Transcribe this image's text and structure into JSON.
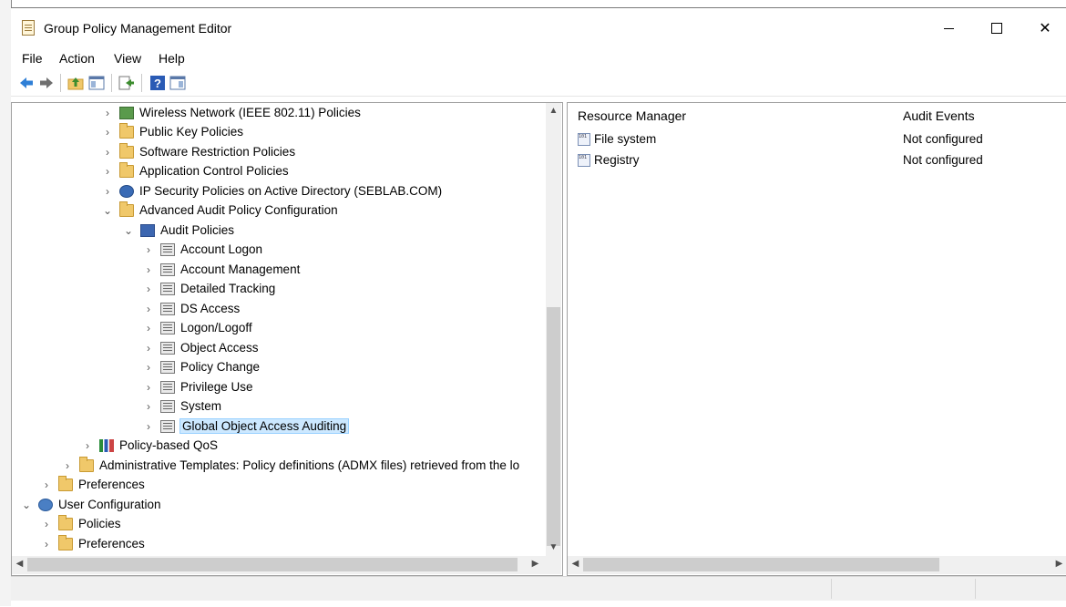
{
  "window": {
    "title": "Group Policy Management Editor"
  },
  "window_controls": {
    "minimize": "",
    "maximize": "",
    "close": "✕"
  },
  "menu": [
    "File",
    "Action",
    "View",
    "Help"
  ],
  "toolbar": {
    "buttons": [
      "back-icon",
      "forward-icon",
      "up-folder-icon",
      "show-hide-tree-icon",
      "export-list-icon",
      "help-icon",
      "properties-icon"
    ]
  },
  "tree": {
    "items": [
      {
        "label": "Wireless Network (IEEE 802.11) Policies",
        "icon": "network-icon",
        "expanded": false
      },
      {
        "label": "Public Key Policies",
        "icon": "folder-icon",
        "expanded": false
      },
      {
        "label": "Software Restriction Policies",
        "icon": "folder-icon",
        "expanded": false
      },
      {
        "label": "Application Control Policies",
        "icon": "folder-icon",
        "expanded": false
      },
      {
        "label": "IP Security Policies on Active Directory (SEBLAB.COM)",
        "icon": "ipsec-icon",
        "expanded": false
      },
      {
        "label": "Advanced Audit Policy Configuration",
        "icon": "folder-icon",
        "expanded": true
      },
      {
        "label": "Audit Policies",
        "icon": "audit-icon",
        "expanded": true
      },
      {
        "label": "Account Logon",
        "icon": "policy-icon",
        "expanded": false
      },
      {
        "label": "Account Management",
        "icon": "policy-icon",
        "expanded": false
      },
      {
        "label": "Detailed Tracking",
        "icon": "policy-icon",
        "expanded": false
      },
      {
        "label": "DS Access",
        "icon": "policy-icon",
        "expanded": false
      },
      {
        "label": "Logon/Logoff",
        "icon": "policy-icon",
        "expanded": false
      },
      {
        "label": "Object Access",
        "icon": "policy-icon",
        "expanded": false
      },
      {
        "label": "Policy Change",
        "icon": "policy-icon",
        "expanded": false
      },
      {
        "label": "Privilege Use",
        "icon": "policy-icon",
        "expanded": false
      },
      {
        "label": "System",
        "icon": "policy-icon",
        "expanded": false
      },
      {
        "label": "Global Object Access Auditing",
        "icon": "policy-icon",
        "expanded": false,
        "selected": true
      },
      {
        "label": "Policy-based QoS",
        "icon": "qos-icon",
        "expanded": false
      },
      {
        "label": "Administrative Templates: Policy definitions (ADMX files) retrieved from the lo",
        "icon": "folder-icon",
        "expanded": false
      },
      {
        "label": "Preferences",
        "icon": "folder-icon",
        "expanded": false
      },
      {
        "label": "User Configuration",
        "icon": "user-config-icon",
        "expanded": true
      },
      {
        "label": "Policies",
        "icon": "folder-icon",
        "expanded": false
      },
      {
        "label": "Preferences",
        "icon": "folder-icon",
        "expanded": false
      }
    ],
    "chevron_collapsed": "›",
    "chevron_expanded": "⌄"
  },
  "details": {
    "columns": [
      "Resource Manager",
      "Audit Events"
    ],
    "rows": [
      {
        "name": "File system",
        "value": "Not configured",
        "icon": "binary-file-icon"
      },
      {
        "name": "Registry",
        "value": "Not configured",
        "icon": "binary-file-icon"
      }
    ]
  },
  "scroll_arrows": {
    "up": "▲",
    "down": "▼",
    "left": "◀",
    "right": "▶"
  }
}
